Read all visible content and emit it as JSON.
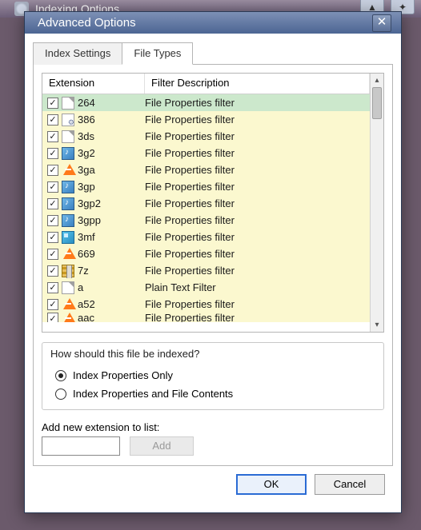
{
  "parent_window": {
    "title": "Indexing Options"
  },
  "dialog": {
    "title": "Advanced Options",
    "close_glyph": "✕",
    "tabs": [
      {
        "label": "Index Settings",
        "active": false
      },
      {
        "label": "File Types",
        "active": true
      }
    ],
    "listview": {
      "columns": {
        "extension": "Extension",
        "description": "Filter Description"
      },
      "rows": [
        {
          "ext": "264",
          "desc": "File Properties filter",
          "icon": "fi-page",
          "checked": true,
          "selected": true
        },
        {
          "ext": "386",
          "desc": "File Properties filter",
          "icon": "fi-pagegear",
          "checked": true
        },
        {
          "ext": "3ds",
          "desc": "File Properties filter",
          "icon": "fi-page",
          "checked": true
        },
        {
          "ext": "3g2",
          "desc": "File Properties filter",
          "icon": "fi-media",
          "checked": true
        },
        {
          "ext": "3ga",
          "desc": "File Properties filter",
          "icon": "fi-cone",
          "checked": true
        },
        {
          "ext": "3gp",
          "desc": "File Properties filter",
          "icon": "fi-media",
          "checked": true
        },
        {
          "ext": "3gp2",
          "desc": "File Properties filter",
          "icon": "fi-media",
          "checked": true
        },
        {
          "ext": "3gpp",
          "desc": "File Properties filter",
          "icon": "fi-media",
          "checked": true
        },
        {
          "ext": "3mf",
          "desc": "File Properties filter",
          "icon": "fi-cube",
          "checked": true
        },
        {
          "ext": "669",
          "desc": "File Properties filter",
          "icon": "fi-cone",
          "checked": true
        },
        {
          "ext": "7z",
          "desc": "File Properties filter",
          "icon": "fi-archive",
          "checked": true
        },
        {
          "ext": "a",
          "desc": "Plain Text Filter",
          "icon": "fi-page",
          "checked": true
        },
        {
          "ext": "a52",
          "desc": "File Properties filter",
          "icon": "fi-cone",
          "checked": true
        },
        {
          "ext": "aac",
          "desc": "File Properties filter",
          "icon": "fi-cone",
          "checked": true,
          "partial": true
        }
      ]
    },
    "index_group": {
      "title": "How should this file be indexed?",
      "options": [
        {
          "label": "Index Properties Only",
          "selected": true
        },
        {
          "label": "Index Properties and File Contents",
          "selected": false
        }
      ]
    },
    "add": {
      "label": "Add new extension to list:",
      "value": "",
      "button": "Add"
    },
    "buttons": {
      "ok": "OK",
      "cancel": "Cancel"
    }
  }
}
